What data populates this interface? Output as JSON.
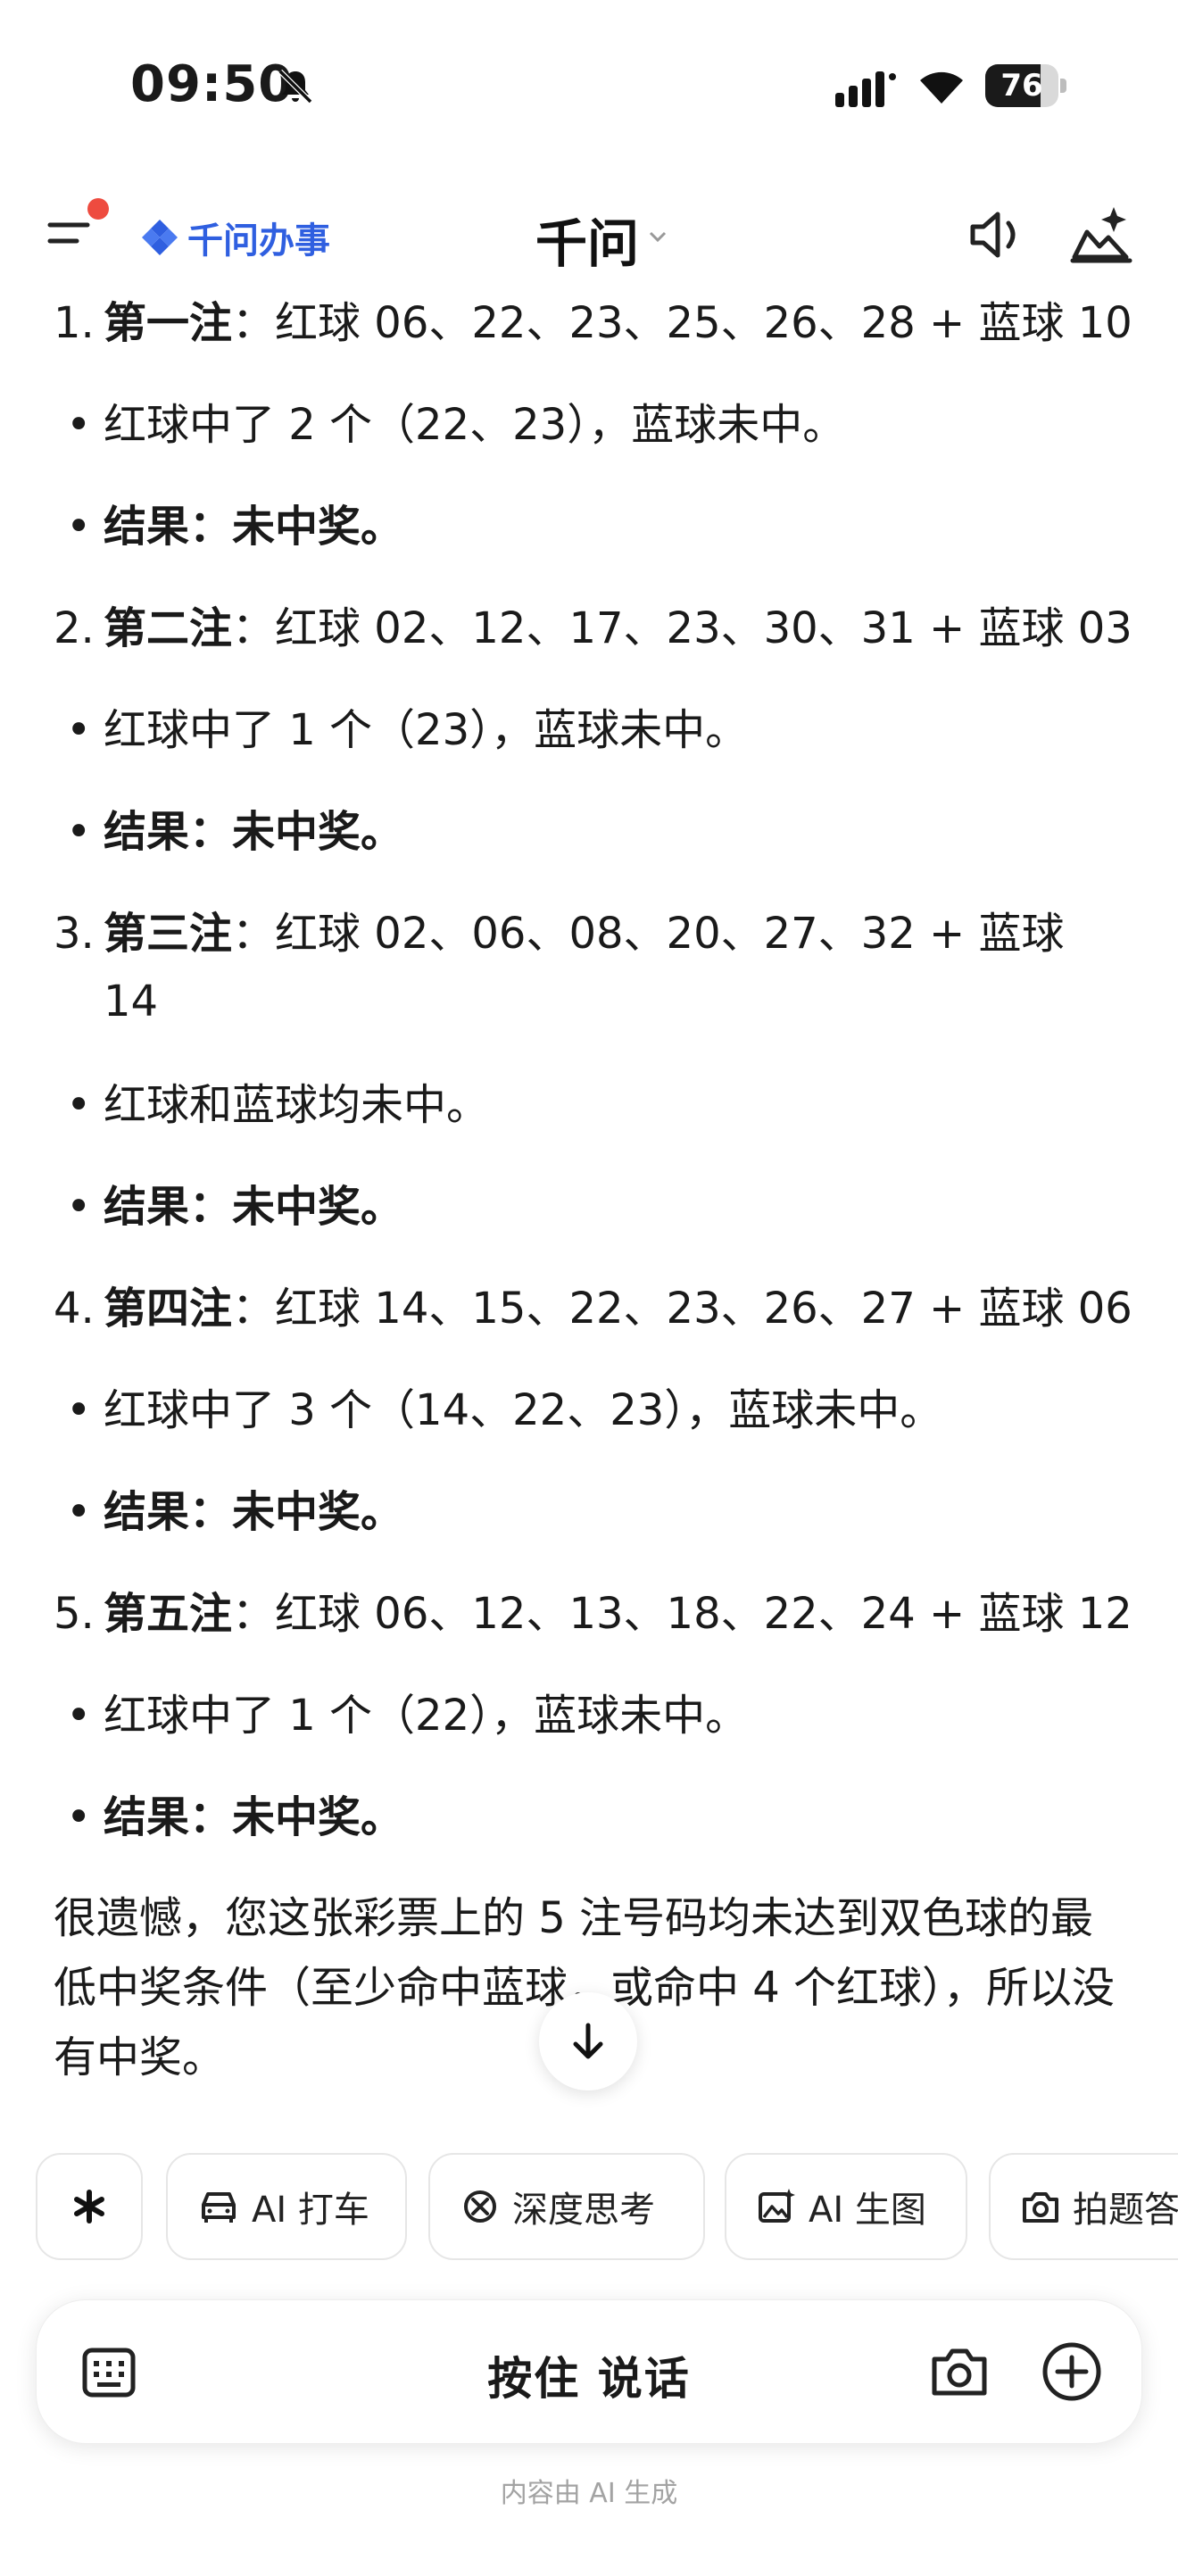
{
  "status_bar": {
    "time": "09:50",
    "battery": "76",
    "battery_level": 0.76
  },
  "header": {
    "logo_text": "千问办事",
    "title": "千问"
  },
  "items": [
    {
      "num": "1.",
      "label": "第一注",
      "text": "红球 06、22、23、25、26、28 + 蓝球 10",
      "detail": "红球中了 2 个（22、23），蓝球未中。",
      "result_label": "结果",
      "result": "未中奖。"
    },
    {
      "num": "2.",
      "label": "第二注",
      "text": "红球 02、12、17、23、30、31 + 蓝球 03",
      "detail": "红球中了 1 个（23），蓝球未中。",
      "result_label": "结果",
      "result": "未中奖。"
    },
    {
      "num": "3.",
      "label": "第三注",
      "text": "红球 02、06、08、20、27、32 + 蓝球 14",
      "detail": "红球和蓝球均未中。",
      "result_label": "结果",
      "result": "未中奖。"
    },
    {
      "num": "4.",
      "label": "第四注",
      "text": "红球 14、15、22、23、26、27 + 蓝球 06",
      "detail": "红球中了 3 个（14、22、23），蓝球未中。",
      "result_label": "结果",
      "result": "未中奖。"
    },
    {
      "num": "5.",
      "label": "第五注",
      "text": "红球 06、12、13、18、22、24 + 蓝球 12",
      "detail": "红球中了 1 个（22），蓝球未中。",
      "result_label": "结果",
      "result": "未中奖。"
    }
  ],
  "summary": "很遗憾，您这张彩票上的 5 注号码均未达到双色球的最低中奖条件（至少命中蓝球，或命中 4 个红球），所以没有中奖。",
  "chips": [
    {
      "label": "AI 打车",
      "icon": "car-icon"
    },
    {
      "label": "深度思考",
      "icon": "brain-icon"
    },
    {
      "label": "AI 生图",
      "icon": "image-icon"
    },
    {
      "label": "拍题答",
      "icon": "camera-icon"
    }
  ],
  "input_bar": {
    "talk_label": "按住 说话"
  },
  "disclaimer": "内容由 AI 生成"
}
